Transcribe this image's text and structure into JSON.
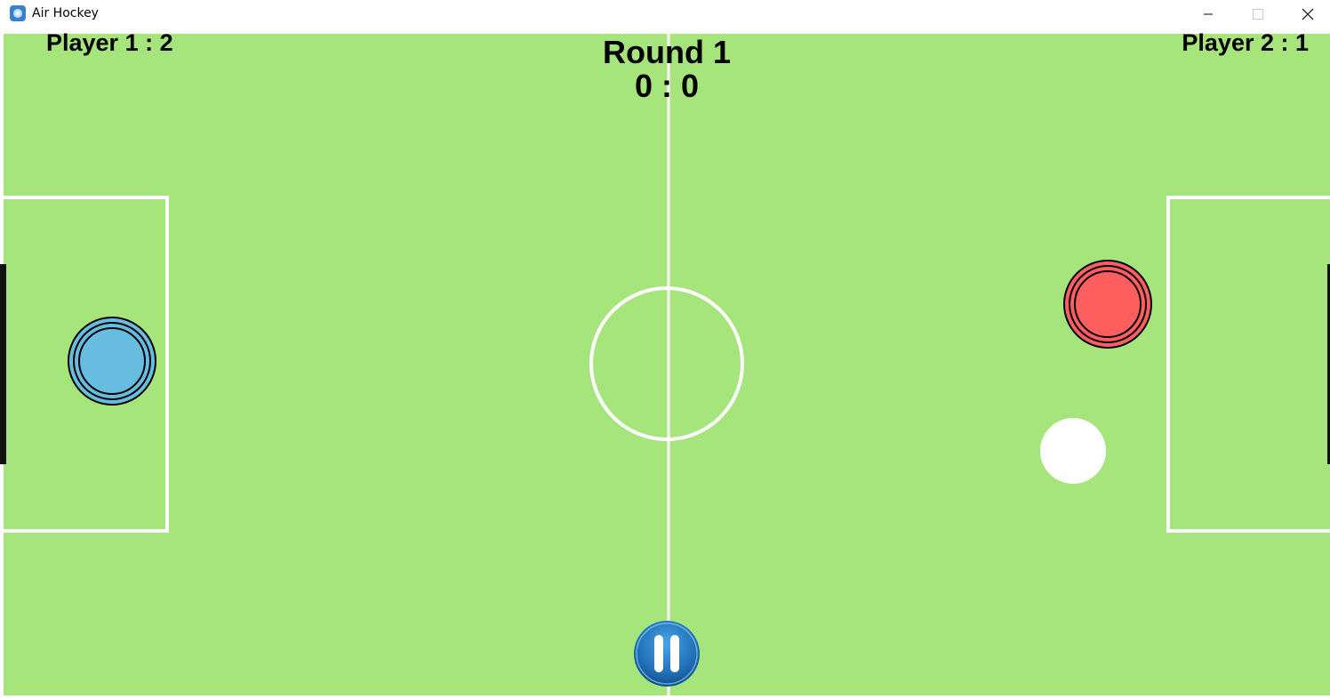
{
  "window": {
    "title": "Air Hockey",
    "controls": {
      "minimize": "minimize-icon",
      "maximize": "maximize-icon",
      "close": "close-icon"
    }
  },
  "scoreboard": {
    "player1_label": "Player 1 : 2",
    "player2_label": "Player 2 : 1",
    "round_label": "Round 1",
    "round_score": "0 : 0"
  },
  "players": {
    "player1": {
      "score": 2,
      "round_goals": 0,
      "color": "#66bde0"
    },
    "player2": {
      "score": 1,
      "round_goals": 0,
      "color": "#ff5e5e"
    }
  },
  "round": {
    "number": 1
  },
  "colors": {
    "field": "#a6e57b",
    "lines": "#ffffff",
    "puck": "#ffffff",
    "pause_button": "#1f6fb5"
  },
  "controls": {
    "pause_icon": "pause-icon"
  }
}
